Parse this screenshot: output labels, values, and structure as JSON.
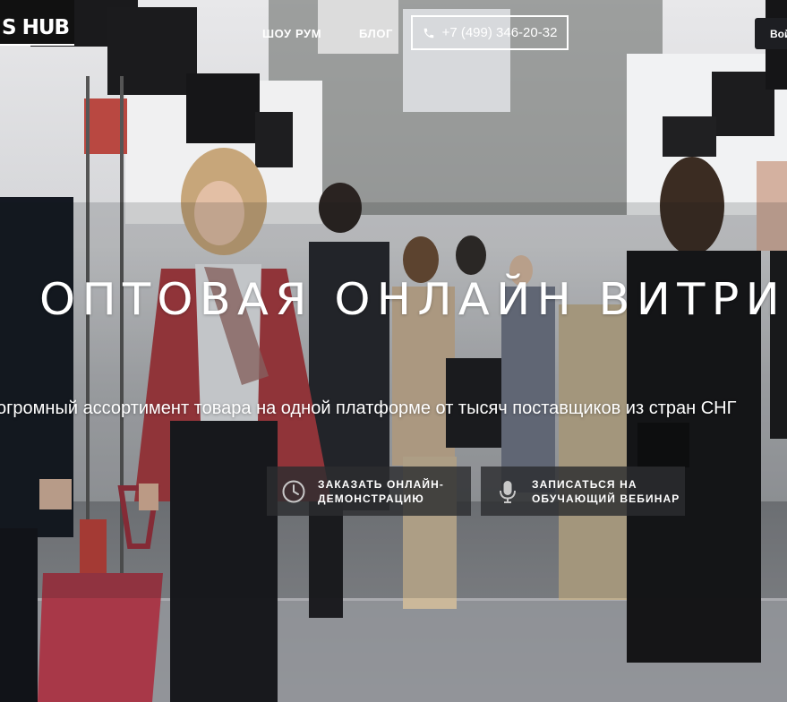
{
  "header": {
    "logo_text": "S HUB",
    "nav": [
      {
        "label": "ШОУ РУМ"
      },
      {
        "label": "БЛОГ"
      }
    ],
    "phone": "+7 (499) 346-20-32",
    "login_label": "Вой"
  },
  "hero": {
    "headline": "ОПТОВАЯ ОНЛАЙН ВИТРИ",
    "subline": "огромный ассортимент товара на одной платформе от тысяч поставщиков из стран СНГ"
  },
  "cta": [
    {
      "line1": "ЗАКАЗАТЬ ОНЛАЙН-",
      "line2": "ДЕМОНСТРАЦИЮ",
      "icon": "clock-icon"
    },
    {
      "line1": "ЗАПИСАТЬСЯ НА",
      "line2": "ОБУЧАЮЩИЙ ВЕБИНАР",
      "icon": "microphone-icon"
    }
  ],
  "colors": {
    "cta_background": "#2c2d30",
    "phone_border": "#ffffff",
    "bag": "#a83848",
    "jacket": "#a93a40"
  }
}
